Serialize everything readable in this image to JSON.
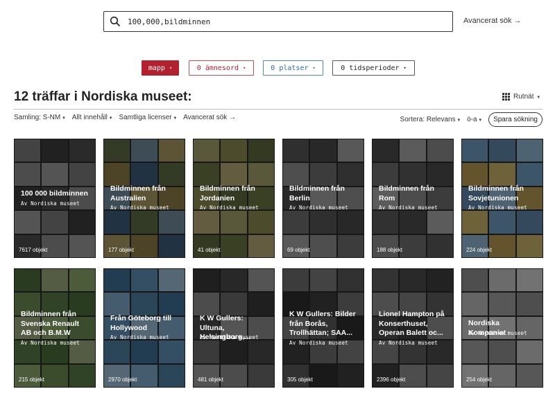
{
  "search": {
    "value": "100,000,bildminnen",
    "advanced_link": "Avancerat sök →"
  },
  "pills": {
    "mapp": "mapp",
    "amnesord": "0 ämnesord",
    "platser": "0 platser",
    "tidsperioder": "0 tidsperioder",
    "caret": "▾"
  },
  "heading": {
    "title": "12 träffar i Nordiska museet:",
    "view_label": "Rutnät"
  },
  "filters": {
    "samling": "Samling: S-NM",
    "innehall": "Allt innehåll",
    "licenser": "Samtliga licenser",
    "advanced": "Avancerat sök →",
    "sort": "Sortera: Relevans",
    "order": "ö-a",
    "save": "Spara sökning",
    "caret": "▾"
  },
  "cards": [
    {
      "title": "100 000 bildminnen",
      "by": "Av Nordiska museet",
      "count": "7617 objekt",
      "palette": [
        "#7a7a7a",
        "#4e4e4e",
        "#9a9a9a",
        "#3c3c3c",
        "#8a8a8a"
      ]
    },
    {
      "title": "Bildminnen från Australien",
      "by": "Av Nordiska museet",
      "count": "177 objekt",
      "palette": [
        "#8c7d4a",
        "#5d6b45",
        "#a89a62",
        "#3d5e7a",
        "#6f8a9b"
      ]
    },
    {
      "title": "Bildminnen från Jordanien",
      "by": "Av Nordiska museet",
      "count": "41 objekt",
      "palette": [
        "#8a8a52",
        "#6b7540",
        "#a4a06a",
        "#5f6a3e",
        "#b5a875"
      ]
    },
    {
      "title": "Bildminnen från Berlin",
      "by": "Av Nordiska museet",
      "count": "69 objekt",
      "palette": [
        "#6e6e6e",
        "#4a4a4a",
        "#8e8e8e",
        "#565656",
        "#a0a0a0"
      ]
    },
    {
      "title": "Bildminnen från Rom",
      "by": "Av Nordiska museet",
      "count": "188 objekt",
      "palette": [
        "#8a8a8a",
        "#5a5a5a",
        "#a6a6a6",
        "#6e6e6e",
        "#4c4c4c"
      ]
    },
    {
      "title": "Bildminnen från Sovjetunionen",
      "by": "Av Nordiska museet",
      "count": "224 objekt",
      "palette": [
        "#6f9bc0",
        "#8eb4d0",
        "#c9b36a",
        "#5f87a8",
        "#b59a55"
      ]
    },
    {
      "title": "Bildminnen från Svenska Renault AB och B.M.W",
      "by": "Av Nordiska museet",
      "count": "215 objekt",
      "palette": [
        "#6a8a4f",
        "#4d6d3a",
        "#8ba76a",
        "#5a7a45",
        "#9aa87a"
      ]
    },
    {
      "title": "Från Göteborg till Hollywood",
      "by": "Av Nordiska museet",
      "count": "2970 objekt",
      "palette": [
        "#5f8fb5",
        "#7fa8c8",
        "#3e6e94",
        "#9cbcd4",
        "#4f7ea2"
      ]
    },
    {
      "title": "K W Gullers: Ultuna, Helsingborg,...",
      "by": "Av Nordiska museet",
      "count": "481 objekt",
      "palette": [
        "#6a6a6a",
        "#4a4a4a",
        "#8a8a8a",
        "#3a3a3a",
        "#9a9a9a"
      ]
    },
    {
      "title": "K W Gullers: Bilder från Borås, Trollhättan; SAA...",
      "by": "Av Nordiska museet",
      "count": "305 objekt",
      "palette": [
        "#5a5a5a",
        "#3c3c3c",
        "#7a7a7a",
        "#2e2e2e",
        "#6e6e6e"
      ]
    },
    {
      "title": "Lionel Hampton på Konserthuset, Operan Balett oc...",
      "by": "Av Nordiska museet",
      "count": "2396 objekt",
      "palette": [
        "#5e5e5e",
        "#3e3e3e",
        "#7e7e7e",
        "#4c4c4c",
        "#8c8c8c"
      ]
    },
    {
      "title": "Nordiska Kompaniet",
      "by": "Av Nordiska museet",
      "count": "254 objekt",
      "palette": [
        "#b8b8b8",
        "#8e8e8e",
        "#d0d0d0",
        "#9e9e9e",
        "#c4c4c4"
      ]
    }
  ]
}
